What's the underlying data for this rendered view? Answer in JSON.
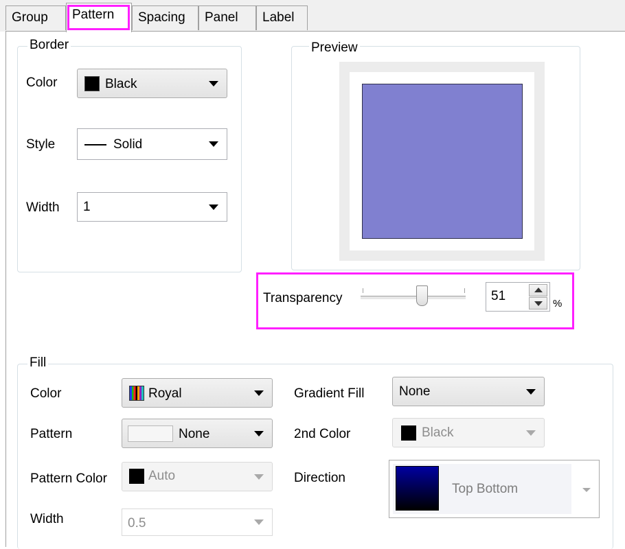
{
  "tabs": {
    "group": "Group",
    "pattern": "Pattern",
    "spacing": "Spacing",
    "panel": "Panel",
    "label": "Label"
  },
  "border": {
    "title": "Border",
    "color_label": "Color",
    "color_value": "Black",
    "style_label": "Style",
    "style_value": "Solid",
    "width_label": "Width",
    "width_value": "1"
  },
  "preview": {
    "title": "Preview",
    "fill_color": "#8080d0"
  },
  "transparency": {
    "label": "Transparency",
    "value": "51",
    "unit": "%",
    "slider_fraction": 0.51
  },
  "fill": {
    "title": "Fill",
    "color_label": "Color",
    "color_value": "Royal",
    "pattern_label": "Pattern",
    "pattern_value": "None",
    "pattern_color_label": "Pattern Color",
    "pattern_color_value": "Auto",
    "width_label": "Width",
    "width_value": "0.5",
    "gradient_label": "Gradient Fill",
    "gradient_value": "None",
    "second_color_label": "2nd Color",
    "second_color_value": "Black",
    "direction_label": "Direction",
    "direction_value": "Top Bottom"
  },
  "colors": {
    "highlight": "#ff1fff",
    "preview_fill": "#8080d0",
    "gradient_top": "#0000a0",
    "gradient_bottom": "#000000"
  },
  "icons": [
    "color-swatch-icon",
    "line-style-icon",
    "dropdown-arrow-icon",
    "spin-up-icon",
    "spin-down-icon",
    "slider-thumb-icon",
    "royal-palette-icon",
    "gradient-swatch-icon"
  ]
}
